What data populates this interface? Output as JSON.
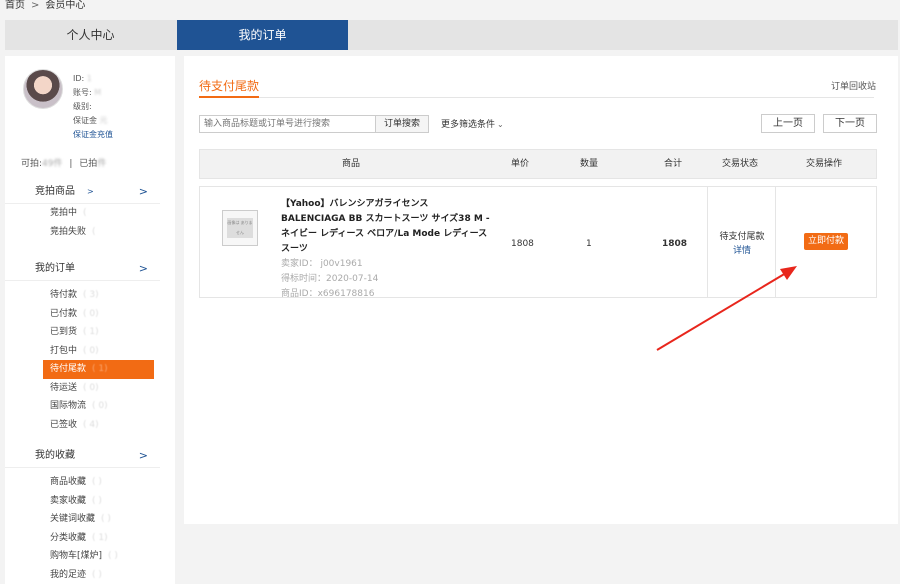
{
  "breadcrumb": {
    "home": "首页",
    "separator": ">",
    "current": "会员中心"
  },
  "tabs": {
    "personal": "个人中心",
    "orders": "我的订单"
  },
  "user": {
    "id_label": "ID:",
    "id_value": "1",
    "account_label": "账号:",
    "account_value": "M",
    "level_label": "级别:",
    "level_value": "",
    "deposit_label": "保证金",
    "deposit_value": "元",
    "recharge_link": "保证金充值"
  },
  "counts": {
    "bidding_label": "可拍:",
    "bidding_value": "49件",
    "separator": "|",
    "bidded_label": "已拍",
    "bidded_value": "件"
  },
  "sidebar": {
    "groups": [
      {
        "title": "竞拍商品",
        "arrow": ">",
        "sub": ">",
        "items": [
          {
            "label": "竞拍中",
            "count": "("
          },
          {
            "label": "竞拍失败",
            "count": "("
          }
        ]
      },
      {
        "title": "我的订单",
        "arrow": ">",
        "items": [
          {
            "label": "待付款",
            "count": "( 3)"
          },
          {
            "label": "已付款",
            "count": "( 0)"
          },
          {
            "label": "已到货",
            "count": "( 1)"
          },
          {
            "label": "打包中",
            "count": "( 0)"
          },
          {
            "label": "待付尾款",
            "count": "( 1)"
          },
          {
            "label": "待运送",
            "count": "( 0)"
          },
          {
            "label": "国际物流",
            "count": "( 0)"
          },
          {
            "label": "已签收",
            "count": "( 4)"
          }
        ]
      },
      {
        "title": "我的收藏",
        "arrow": ">",
        "items": [
          {
            "label": "商品收藏",
            "count": "( )"
          },
          {
            "label": "卖家收藏",
            "count": "( )"
          },
          {
            "label": "关键词收藏",
            "count": "( )"
          },
          {
            "label": "分类收藏",
            "count": "( 1)"
          },
          {
            "label": "购物车[煤炉]",
            "count": "( )"
          },
          {
            "label": "我的足迹",
            "count": "( )"
          }
        ]
      }
    ]
  },
  "main": {
    "title": "待支付尾款",
    "recycle": "订单回收站",
    "search_placeholder": "输入商品标题或订单号进行搜索",
    "search_button": "订单搜索",
    "filter": "更多筛选条件",
    "filter_icon": "chevron-down-icon",
    "prev": "上一页",
    "next": "下一页",
    "columns": [
      "商品",
      "单价",
      "数量",
      "合计",
      "交易状态",
      "交易操作"
    ],
    "order": {
      "thumb_text": "画像は ありません",
      "title": "【Yahoo】バレンシアガライセンス BALENCIAGA BB スカートスーツ サイズ38 M - ネイビー レディース ベロア/La Mode レディース スーツ",
      "seller": "卖家ID： j00v1961",
      "end_time": "得标时间：2020-07-14",
      "product_id": "商品ID：x696178816",
      "price": "1808",
      "qty": "1",
      "total": "1808",
      "status": "待支付尾款",
      "detail": "详情",
      "pay_button": "立即付款"
    }
  },
  "colors": {
    "accent": "#f26b14",
    "brand": "#1f5394",
    "annotation_arrow": "#e8261c"
  }
}
